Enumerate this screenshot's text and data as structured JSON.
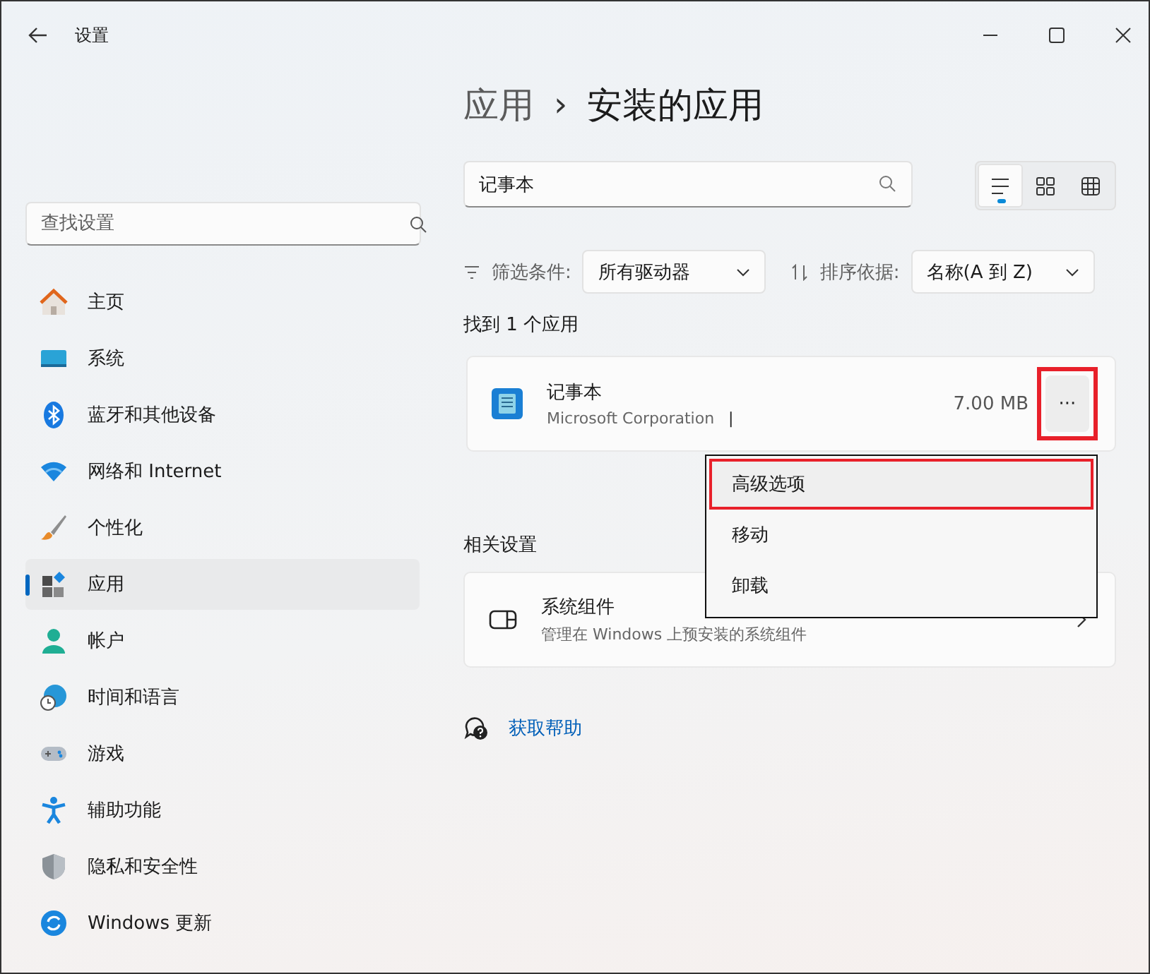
{
  "window": {
    "title": "设置"
  },
  "sidebar": {
    "search": {
      "placeholder": "查找设置"
    },
    "items": [
      {
        "label": "主页",
        "selected": false
      },
      {
        "label": "系统",
        "selected": false
      },
      {
        "label": "蓝牙和其他设备",
        "selected": false
      },
      {
        "label": "网络和 Internet",
        "selected": false
      },
      {
        "label": "个性化",
        "selected": false
      },
      {
        "label": "应用",
        "selected": true
      },
      {
        "label": "帐户",
        "selected": false
      },
      {
        "label": "时间和语言",
        "selected": false
      },
      {
        "label": "游戏",
        "selected": false
      },
      {
        "label": "辅助功能",
        "selected": false
      },
      {
        "label": "隐私和安全性",
        "selected": false
      },
      {
        "label": "Windows 更新",
        "selected": false
      }
    ]
  },
  "breadcrumb": {
    "parent": "应用",
    "separator": "›",
    "current": "安装的应用"
  },
  "search": {
    "value": "记事本"
  },
  "view_modes": [
    {
      "kind": "list",
      "selected": true
    },
    {
      "kind": "tiles",
      "selected": false
    },
    {
      "kind": "grid",
      "selected": false
    }
  ],
  "filter": {
    "label": "筛选条件:",
    "value": "所有驱动器"
  },
  "sort": {
    "label": "排序依据:",
    "value": "名称(A 到 Z)"
  },
  "result_count": "找到 1 个应用",
  "apps": [
    {
      "name": "记事本",
      "publisher": "Microsoft Corporation",
      "separator": "|",
      "size": "7.00 MB",
      "more": "···",
      "highlighted": true
    }
  ],
  "menu": {
    "items": [
      {
        "label": "高级选项",
        "highlighted": true
      },
      {
        "label": "移动",
        "highlighted": false
      },
      {
        "label": "卸载",
        "highlighted": false
      }
    ]
  },
  "related": {
    "heading": "相关设置",
    "items": [
      {
        "title": "系统组件",
        "subtitle": "管理在 Windows 上预安装的系统组件"
      }
    ]
  },
  "help": {
    "label": "获取帮助"
  }
}
